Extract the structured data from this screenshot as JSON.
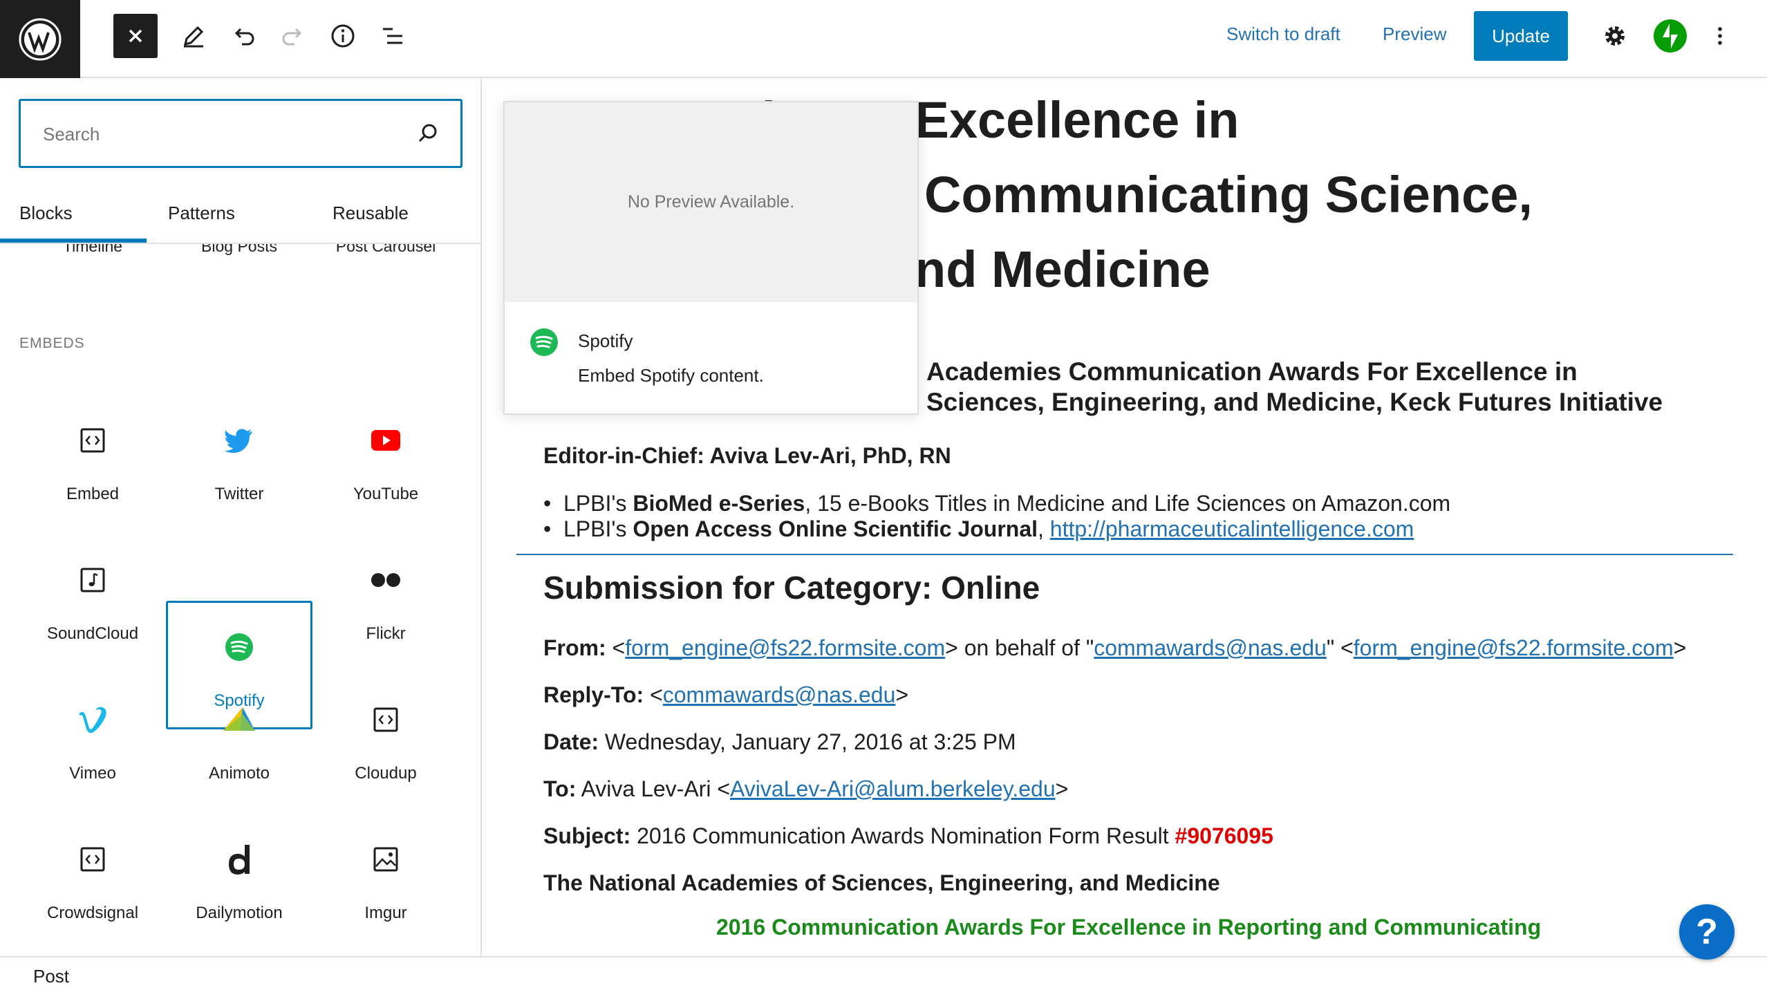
{
  "header": {
    "switch_to_draft": "Switch to draft",
    "preview": "Preview",
    "update": "Update"
  },
  "sidebar": {
    "search_placeholder": "Search",
    "tabs": [
      "Blocks",
      "Patterns",
      "Reusable"
    ],
    "cut_items": [
      "Timeline",
      "Blog Posts",
      "Post Carousel"
    ],
    "section": "EMBEDS",
    "blocks": [
      {
        "label": "Embed",
        "icon": "embed-icon"
      },
      {
        "label": "Twitter",
        "icon": "twitter-icon"
      },
      {
        "label": "YouTube",
        "icon": "youtube-icon"
      },
      {
        "label": "SoundCloud",
        "icon": "soundcloud-icon"
      },
      {
        "label": "Spotify",
        "icon": "spotify-icon",
        "selected": true
      },
      {
        "label": "Flickr",
        "icon": "flickr-icon"
      },
      {
        "label": "Vimeo",
        "icon": "vimeo-icon"
      },
      {
        "label": "Animoto",
        "icon": "animoto-icon"
      },
      {
        "label": "Cloudup",
        "icon": "cloudup-icon"
      },
      {
        "label": "Crowdsignal",
        "icon": "crowdsignal-icon"
      },
      {
        "label": "Dailymotion",
        "icon": "dailymotion-icon"
      },
      {
        "label": "Imgur",
        "icon": "imgur-icon"
      }
    ]
  },
  "popup": {
    "no_preview": "No Preview Available.",
    "title": "Spotify",
    "description": "Embed Spotify content."
  },
  "content": {
    "title_lines": [
      "on Awards For Excellence in",
      "Communicating Science,",
      "nd Medicine"
    ],
    "subtitle_lines": [
      "Academies Communication Awards For Excellence in",
      "Sciences, Engineering, and Medicine, Keck Futures Initiative"
    ],
    "editor_label": "Editor-in-Chief: Aviva Lev-Ari, PhD, RN",
    "bullet1": {
      "prefix": "LPBI's ",
      "bold": "BioMed e-Series",
      "rest": ", 15 e-Books Titles in Medicine and Life Sciences on Amazon.com"
    },
    "bullet2": {
      "prefix": "LPBI's ",
      "bold": "Open Access Online Scientific Journal",
      "rest": ", ",
      "link": "http://pharmaceuticalintelligence.com"
    },
    "section_heading": "Submission for Category: Online",
    "from": {
      "label": "From:",
      "t1": " <",
      "link1": "form_engine@fs22.formsite.com",
      "t2": "> on behalf of \"",
      "link2": "commawards@nas.edu",
      "t3": "\" <",
      "link3": "form_engine@fs22.formsite.com",
      "t4": ">"
    },
    "reply_to": {
      "label": "Reply-To:",
      "t1": " <",
      "link": "commawards@nas.edu",
      "t2": ">"
    },
    "date": {
      "label": "Date:",
      "value": " Wednesday, January 27, 2016 at 3:25 PM"
    },
    "to": {
      "label": "To:",
      "t1": " Aviva Lev-Ari <",
      "link": "AvivaLev-Ari@alum.berkeley.edu",
      "t2": ">"
    },
    "subject": {
      "label": "Subject:",
      "value": " 2016 Communication Awards Nomination Form Result ",
      "number": "#9076095"
    },
    "org": "The National Academies of Sciences, Engineering, and Medicine",
    "green_line": "2016 Communication Awards For Excellence in Reporting and Communicating"
  },
  "footer": {
    "label": "Post"
  },
  "help": {
    "label": "?"
  },
  "colors": {
    "accent": "#007cba",
    "link": "#2271b1",
    "jetpack": "#069e08",
    "spotify": "#1db954"
  }
}
